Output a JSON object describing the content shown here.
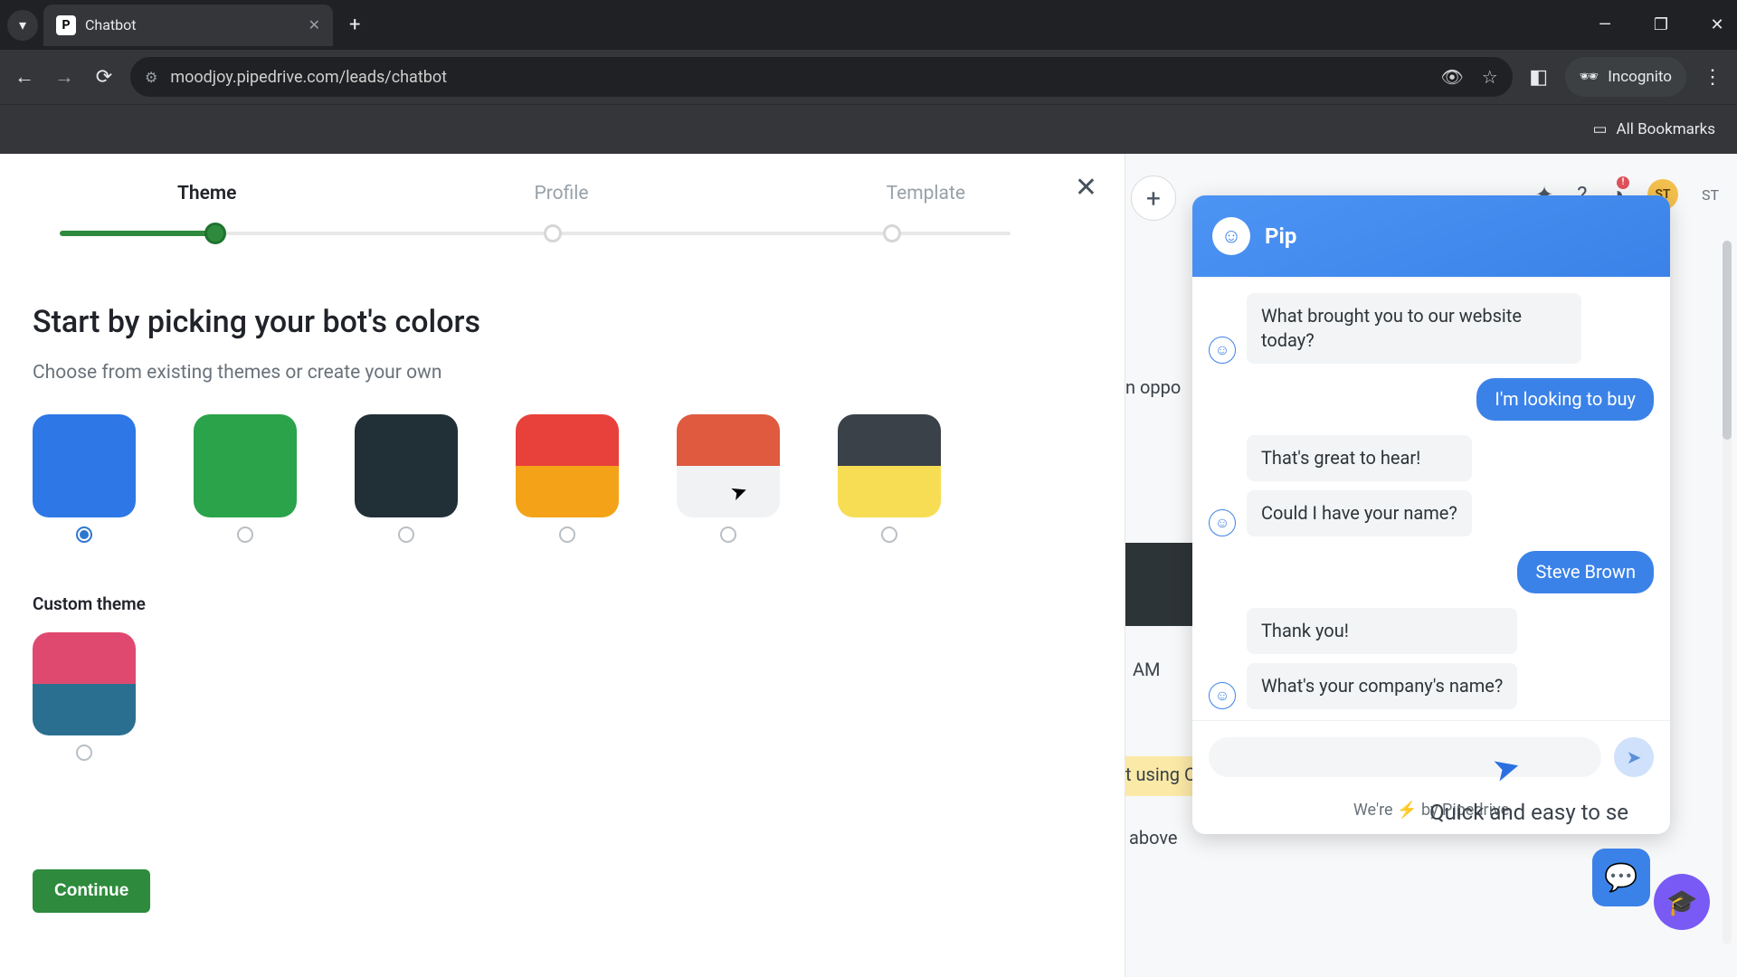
{
  "browser": {
    "tab_title": "Chatbot",
    "tab_favicon_letter": "P",
    "url": "moodjoy.pipedrive.com/leads/chatbot",
    "incognito_label": "Incognito",
    "bookmarks_label": "All Bookmarks"
  },
  "setup": {
    "steps": [
      "Theme",
      "Profile",
      "Template"
    ],
    "active_step_index": 0,
    "headline": "Start by picking your bot's colors",
    "subhead": "Choose from existing themes or create your own",
    "themes": [
      {
        "top": "#2e77e6",
        "bottom": "#2e77e6",
        "selected": true
      },
      {
        "top": "#2aa34a",
        "bottom": "#2aa34a",
        "selected": false
      },
      {
        "top": "#213036",
        "bottom": "#213036",
        "selected": false
      },
      {
        "top": "#e8403a",
        "bottom": "#f4a318",
        "selected": false
      },
      {
        "top": "#df5a3f",
        "bottom": "#f1f2f3",
        "selected": false
      },
      {
        "top": "#3a4149",
        "bottom": "#f7dd54",
        "selected": false
      }
    ],
    "custom_label": "Custom theme",
    "custom_theme": {
      "top": "#e0496f",
      "bottom": "#2a6f90",
      "selected": false
    },
    "continue_label": "Continue"
  },
  "bg": {
    "text_oppo": "n oppo",
    "text_am": "AM",
    "text_using": "t using C",
    "text_above": "above",
    "quick_text": "Quick and easy to se"
  },
  "topbar": {
    "avatar_initials": "ST",
    "st_label": "ST"
  },
  "chat": {
    "bot_name": "Pip",
    "messages": [
      {
        "who": "bot",
        "text": "What brought you to our website today?"
      },
      {
        "who": "user",
        "text": "I'm looking to buy"
      },
      {
        "who": "bot",
        "text": "That's great to hear!"
      },
      {
        "who": "bot",
        "text": "Could I have your name?"
      },
      {
        "who": "user",
        "text": "Steve Brown"
      },
      {
        "who": "bot",
        "text": "Thank you!"
      },
      {
        "who": "bot",
        "text": "What's your company's name?"
      }
    ],
    "input_placeholder": "",
    "footer_prefix": "We're ",
    "footer_suffix": " by Pipedrive"
  }
}
